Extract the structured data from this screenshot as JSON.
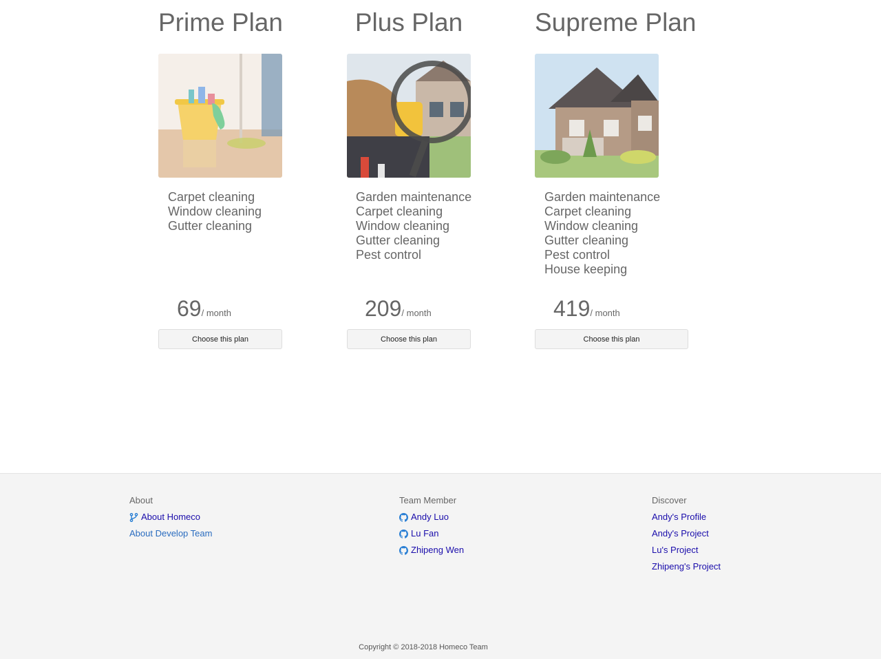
{
  "plans": [
    {
      "title": "Prime Plan",
      "image_icon": "cleaning-supplies-photo",
      "features": [
        "Carpet cleaning",
        "Window cleaning",
        "Gutter cleaning"
      ],
      "price": "69",
      "price_unit": "/ month",
      "button_label": "Choose this plan"
    },
    {
      "title": "Plus Plan",
      "image_icon": "handyman-toolbelt-photo",
      "features": [
        "Garden maintenance",
        "Carpet cleaning",
        "Window cleaning",
        "Gutter cleaning",
        "Pest control"
      ],
      "price": "209",
      "price_unit": "/ month",
      "button_label": "Choose this plan"
    },
    {
      "title": "Supreme Plan",
      "image_icon": "house-exterior-photo",
      "features": [
        "Garden maintenance",
        "Carpet cleaning",
        "Window cleaning",
        "Gutter cleaning",
        "Pest control",
        "House keeping"
      ],
      "price": "419",
      "price_unit": "/ month",
      "button_label": "Choose this plan"
    }
  ],
  "footer": {
    "about": {
      "heading": "About",
      "links": [
        {
          "label": "About Homeco",
          "icon": "code-branch-icon"
        },
        {
          "label": "About Develop Team"
        }
      ]
    },
    "team": {
      "heading": "Team Member",
      "links": [
        {
          "label": "Andy Luo",
          "icon": "github-icon"
        },
        {
          "label": "Lu Fan",
          "icon": "github-icon"
        },
        {
          "label": "Zhipeng Wen",
          "icon": "github-icon"
        }
      ]
    },
    "discover": {
      "heading": "Discover",
      "links": [
        {
          "label": "Andy's Profile"
        },
        {
          "label": "Andy's Project"
        },
        {
          "label": "Lu's Project"
        },
        {
          "label": "Zhipeng's Project"
        }
      ]
    },
    "copyright": "Copyright © 2018-2018 Homeco Team"
  },
  "colors": {
    "text_gray": "#666666",
    "link_blue": "#1a0dab",
    "link_alt_blue": "#2a6cbf",
    "icon_blue": "#2a7fd4",
    "footer_bg": "#f4f4f4"
  }
}
